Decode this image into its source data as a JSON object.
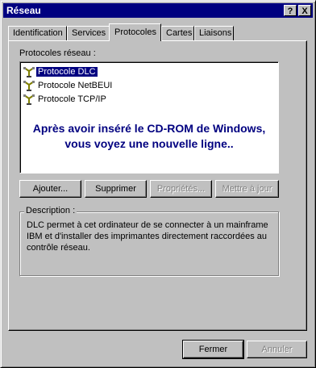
{
  "window": {
    "title": "Réseau",
    "help_button": "?",
    "close_button": "X"
  },
  "tabs": [
    {
      "label": "Identification"
    },
    {
      "label": "Services"
    },
    {
      "label": "Protocoles"
    },
    {
      "label": "Cartes"
    },
    {
      "label": "Liaisons"
    }
  ],
  "protocols_label": "Protocoles réseau :",
  "protocols": [
    {
      "label": "Protocole DLC",
      "selected": true
    },
    {
      "label": "Protocole NetBEUI",
      "selected": false
    },
    {
      "label": "Protocole TCP/IP",
      "selected": false
    }
  ],
  "annotation": {
    "line1": "Après avoir inséré le CD-ROM de Windows,",
    "line2": "vous voyez une nouvelle ligne.."
  },
  "buttons": {
    "add": "Ajouter...",
    "remove": "Supprimer",
    "properties": "Propriétés...",
    "update": "Mettre à jour",
    "close": "Fermer",
    "cancel": "Annuler"
  },
  "description": {
    "label": "Description :",
    "text": "DLC permet à cet ordinateur de se connecter à un mainframe IBM et d'installer des imprimantes directement raccordées au contrôle réseau."
  },
  "colors": {
    "title_bar": "#000080",
    "selection": "#000080",
    "annotation_text": "#000080",
    "face": "#c0c0c0"
  },
  "icons": [
    "network-protocol-icon"
  ]
}
